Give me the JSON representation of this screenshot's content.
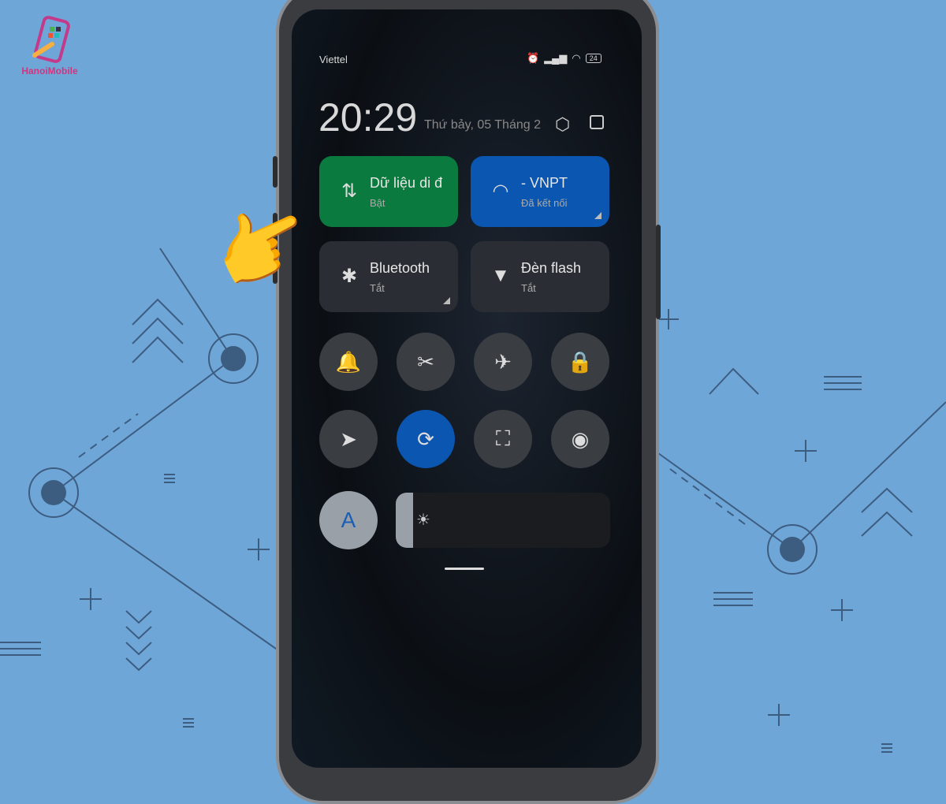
{
  "logo": {
    "text": "HanoiMobile"
  },
  "status_bar": {
    "carrier": "Viettel",
    "battery": "24",
    "icons": [
      "alarm-icon",
      "signal-icon",
      "wifi-icon",
      "battery-icon"
    ]
  },
  "header": {
    "time": "20:29",
    "date": "Thứ bảy, 05 Tháng 2",
    "icons": [
      "settings-icon",
      "edit-icon"
    ]
  },
  "tiles": [
    {
      "label": "Dữ liệu di đ",
      "status": "Bật",
      "icon": "mobile-data-icon",
      "color": "#0b7a3e"
    },
    {
      "label": "- VNPT",
      "status": "Đã kết nối",
      "icon": "wifi-icon",
      "color": "#0b56b0"
    },
    {
      "label": "Bluetooth",
      "status": "Tắt",
      "icon": "bluetooth-icon",
      "color": "#2a2e34"
    },
    {
      "label": "Đèn flash",
      "status": "Tắt",
      "icon": "flashlight-icon",
      "color": "#2a2e34"
    }
  ],
  "toggles": [
    {
      "icon": "bell-icon",
      "glyph": "🔔",
      "active": false
    },
    {
      "icon": "screenshot-icon",
      "glyph": "✂",
      "active": false
    },
    {
      "icon": "airplane-icon",
      "glyph": "✈",
      "active": false
    },
    {
      "icon": "lock-icon",
      "glyph": "🔒",
      "active": false
    },
    {
      "icon": "location-icon",
      "glyph": "➤",
      "active": false
    },
    {
      "icon": "auto-rotate-icon",
      "glyph": "⟳",
      "active": true
    },
    {
      "icon": "scan-icon",
      "glyph": "⛶",
      "active": false
    },
    {
      "icon": "eye-icon",
      "glyph": "◉",
      "active": false
    }
  ],
  "auto_brightness": {
    "label": "A"
  },
  "brightness": {
    "level": 0.08
  },
  "hand_glyph": "👉"
}
